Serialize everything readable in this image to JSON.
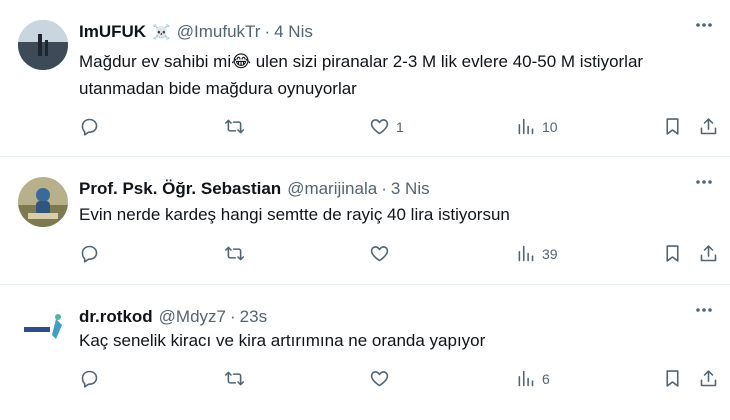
{
  "tweets": [
    {
      "name": "ImUFUK",
      "badge": "☠️",
      "handle": "@ImufukTr",
      "dot": "·",
      "time": "4 Nis",
      "text": "Mağdur ev sahibi mi😂 ulen sizi piranalar 2-3 M lik evlere 40-50 M istiyorlar utanmadan bide mağdura oynuyorlar",
      "likes": "1",
      "views": "10"
    },
    {
      "name": "Prof. Psk. Öğr. Sebastian",
      "handle": "@marijinala",
      "dot": "·",
      "time": "3 Nis",
      "text": "Evin nerde kardeş hangi semtte de rayiç 40 lira istiyorsun",
      "likes": "",
      "views": "39"
    },
    {
      "name": "dr.rotkod",
      "handle": "@Mdyz7",
      "dot": "·",
      "time": "23s",
      "text": "Kaç senelik kiracı ve kira artırımına ne oranda yapıyor",
      "likes": "",
      "views": "6"
    }
  ],
  "icons": {
    "reply": "reply-icon",
    "retweet": "retweet-icon",
    "like": "heart-icon",
    "views": "views-icon",
    "bookmark": "bookmark-icon",
    "share": "share-icon",
    "more": "more-icon"
  },
  "colors": {
    "text": "#0f1419",
    "secondary": "#536471",
    "divider": "#e6ecf0"
  }
}
